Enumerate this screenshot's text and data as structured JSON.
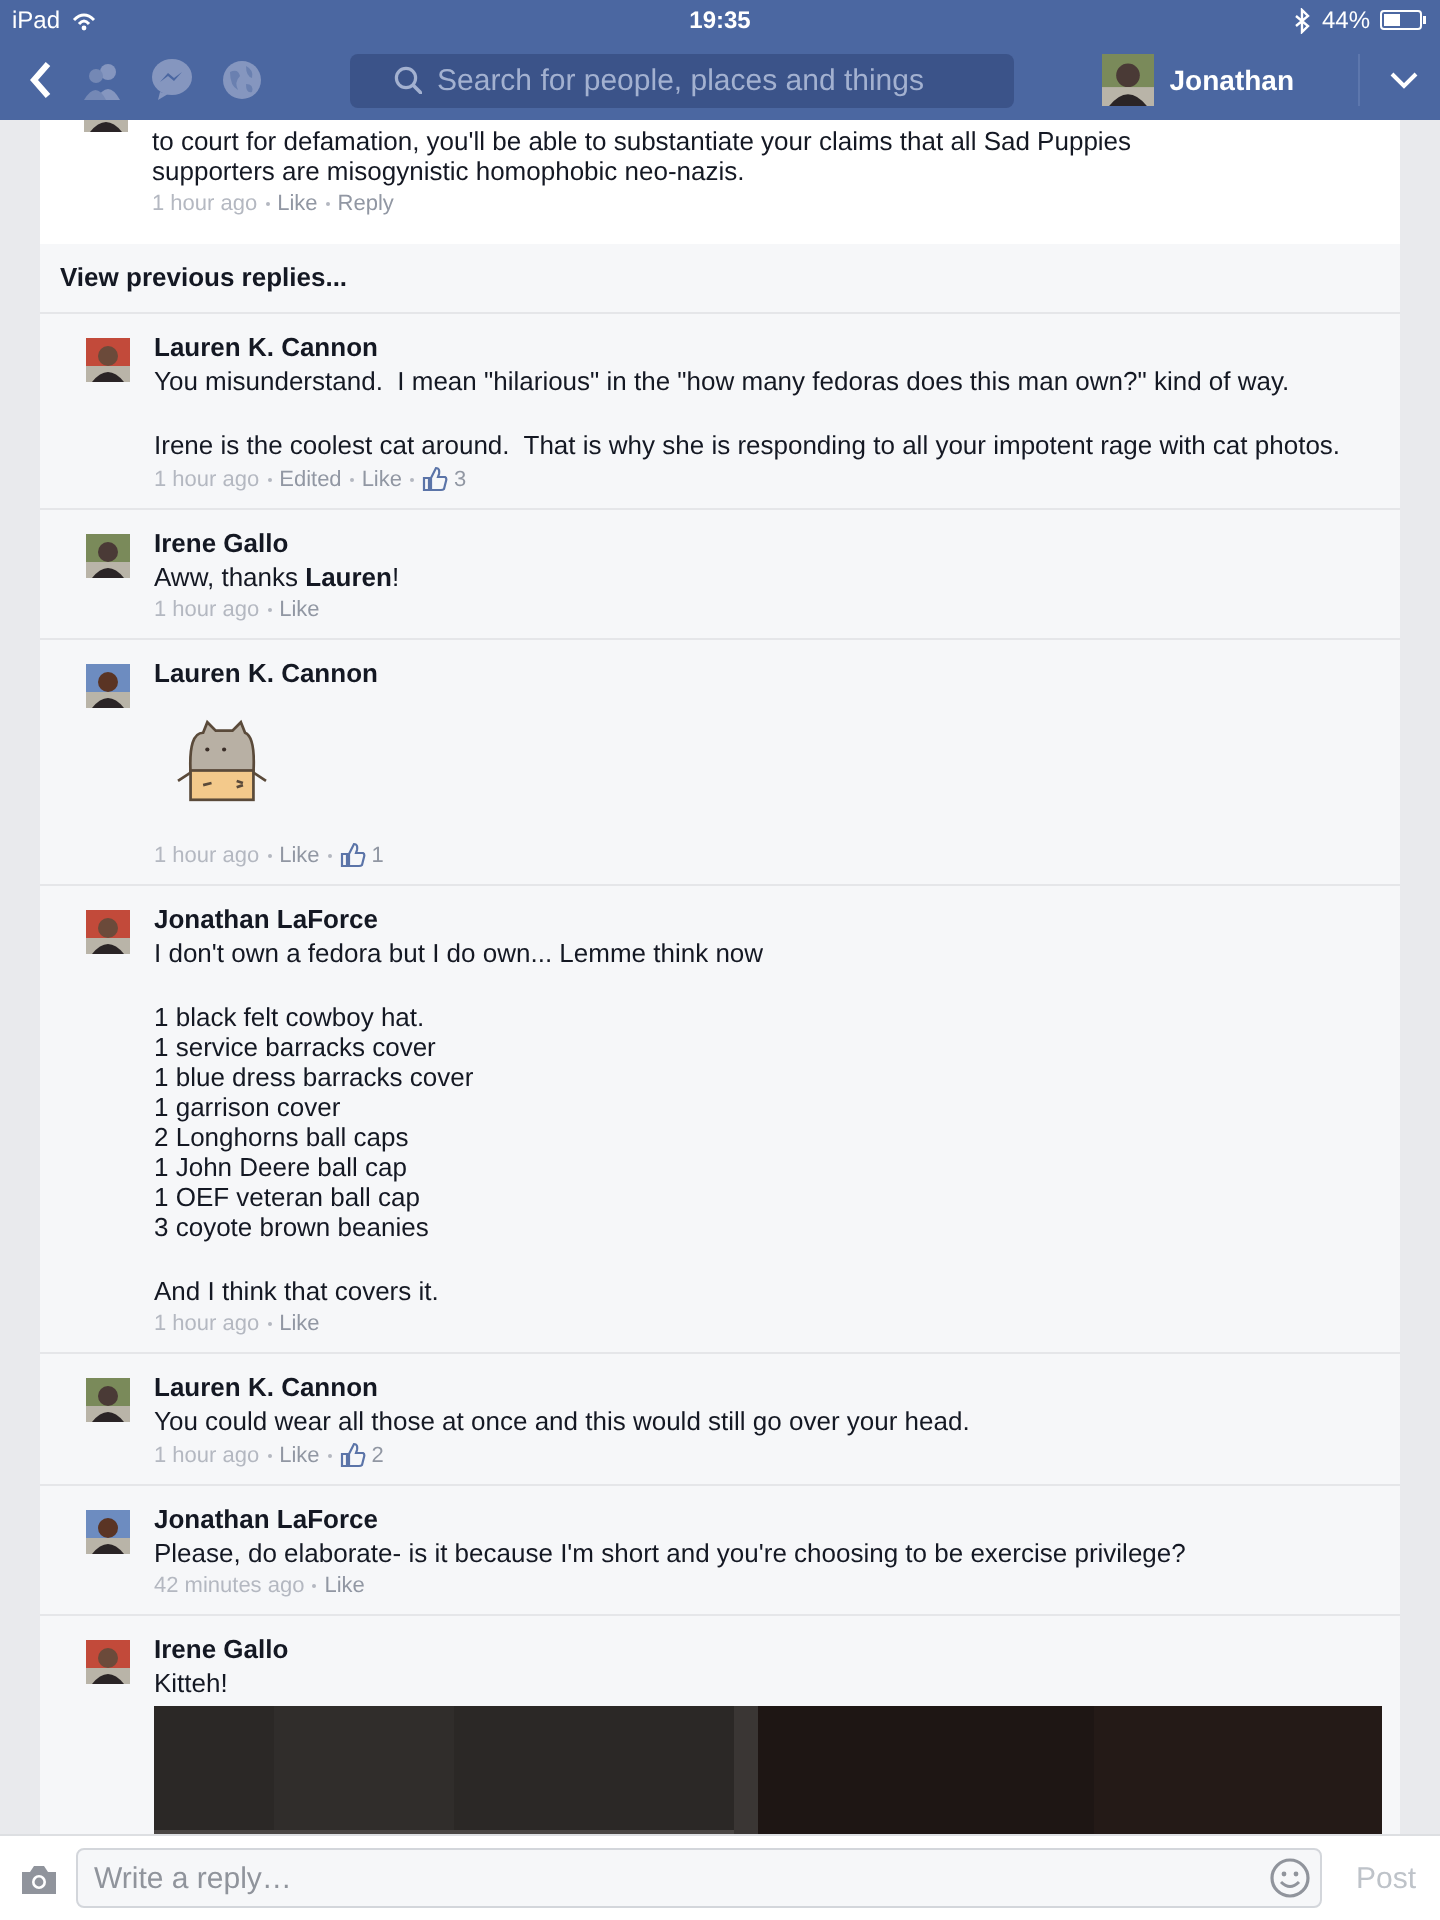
{
  "status_bar": {
    "device": "iPad",
    "time": "19:35",
    "battery": "44%"
  },
  "nav": {
    "search": {
      "placeholder": "Search for people, places and things"
    },
    "user": "Jonathan"
  },
  "top_comment": {
    "body": "to court for defamation, you'll be able to substantiate your claims that all Sad Puppies\nsupporters are misogynistic homophobic neo-nazis.",
    "meta": [
      {
        "kind": "time",
        "text": "1 hour ago"
      },
      {
        "kind": "link",
        "text": "Like"
      },
      {
        "kind": "link",
        "text": "Reply"
      }
    ]
  },
  "view_previous": "View previous replies...",
  "comments": [
    {
      "kind": "text",
      "name": "Lauren K. Cannon",
      "body": [
        "You misunderstand.  I mean \"hilarious\" in the \"how many fedoras does this man own?\" kind of way.",
        "Irene is the coolest cat around.  That is why she is responding to all your impotent rage with cat photos."
      ],
      "meta": [
        {
          "kind": "time",
          "text": "1 hour ago"
        },
        {
          "kind": "link",
          "text": "Edited"
        },
        {
          "kind": "link",
          "text": "Like"
        },
        {
          "kind": "likes",
          "text": "3"
        }
      ]
    },
    {
      "kind": "text",
      "name": "Irene Gallo",
      "body": [
        "Aww, thanks **Lauren**!"
      ],
      "meta": [
        {
          "kind": "time",
          "text": "1 hour ago"
        },
        {
          "kind": "link",
          "text": "Like"
        }
      ]
    },
    {
      "kind": "sticker",
      "name": "Lauren K. Cannon",
      "meta": [
        {
          "kind": "time",
          "text": "1 hour ago"
        },
        {
          "kind": "link",
          "text": "Like"
        },
        {
          "kind": "likes",
          "text": "1"
        }
      ]
    },
    {
      "kind": "text",
      "name": "Jonathan LaForce",
      "body": [
        "I don't own a fedora but I do own... Lemme think now",
        "1 black felt cowboy hat.\n1 service barracks cover\n1 blue dress barracks cover\n1 garrison cover\n2 Longhorns ball caps\n1 John Deere ball cap\n1 OEF veteran ball cap\n3 coyote brown beanies",
        "And I think that covers it."
      ],
      "meta": [
        {
          "kind": "time",
          "text": "1 hour ago"
        },
        {
          "kind": "link",
          "text": "Like"
        }
      ]
    },
    {
      "kind": "text",
      "name": "Lauren K. Cannon",
      "body": [
        "You could wear all those at once and this would still go over your head."
      ],
      "meta": [
        {
          "kind": "time",
          "text": "1 hour ago"
        },
        {
          "kind": "link",
          "text": "Like"
        },
        {
          "kind": "likes",
          "text": "2"
        }
      ]
    },
    {
      "kind": "text",
      "name": "Jonathan LaForce",
      "body": [
        "Please, do elaborate- is it because I'm short and you're choosing to be exercise privilege?"
      ],
      "meta": [
        {
          "kind": "time",
          "text": "42 minutes ago"
        },
        {
          "kind": "link",
          "text": "Like"
        }
      ]
    },
    {
      "name": "Irene Gallo",
      "body": [
        "Kitteh!"
      ]
    }
  ],
  "reply_bar": {
    "placeholder": "Write a reply…",
    "post": "Post"
  }
}
